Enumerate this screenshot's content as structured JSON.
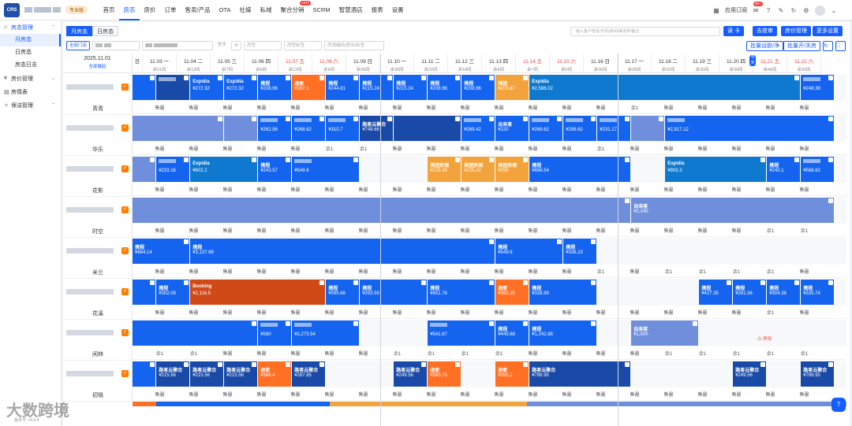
{
  "header": {
    "logo_text": "CRS",
    "pro_badge": "专业版",
    "nav": [
      {
        "label": "首页",
        "active": false,
        "hot": false
      },
      {
        "label": "房态",
        "active": true,
        "hot": false
      },
      {
        "label": "房价",
        "active": false,
        "hot": false
      },
      {
        "label": "订单",
        "active": false,
        "hot": false
      },
      {
        "label": "售卖/产品",
        "active": false,
        "hot": false
      },
      {
        "label": "OTA",
        "active": false,
        "hot": false
      },
      {
        "label": "社媒",
        "active": false,
        "hot": false
      },
      {
        "label": "私域",
        "active": false,
        "hot": false
      },
      {
        "label": "聚合分销",
        "active": false,
        "hot": true
      },
      {
        "label": "SCRM",
        "active": false,
        "hot": false
      },
      {
        "label": "智慧酒店",
        "active": false,
        "hot": false
      },
      {
        "label": "报表",
        "active": false,
        "hot": false
      },
      {
        "label": "设置",
        "active": false,
        "hot": false
      }
    ],
    "hot_label": "HOT",
    "apps_label": "应用订阅",
    "notify_count": "99+"
  },
  "sidebar": {
    "groups": [
      {
        "label": "房态管理",
        "icon": "home-icon",
        "subs": [
          "月房态",
          "日房态",
          "房态日志"
        ]
      },
      {
        "label": "房价管理",
        "icon": "price-icon",
        "subs": []
      },
      {
        "label": "房情表",
        "icon": "table-icon",
        "subs": []
      },
      {
        "label": "保洁管理",
        "icon": "broom-icon",
        "subs": []
      }
    ],
    "version": "版本号: v4.9.8"
  },
  "toolbar": {
    "tabs": [
      "月房态",
      "日房态"
    ],
    "search_placeholder": "输入客户姓名/手机/房间/渠道单/备注",
    "buttons": [
      "读 卡",
      "去夜审",
      "房价管理",
      "更多设置"
    ],
    "filter_all": "全部门店",
    "filter_more": "更多",
    "filter_type": "房型",
    "filter_tag": "房型标签",
    "filter_search": "房源编码/房间/标签",
    "batch_buttons": [
      "批量设脏/净",
      "批量开/关房"
    ]
  },
  "calendar": {
    "start_date": "2025.11.01",
    "expand_label": "全部展起",
    "days": [
      {
        "d": "日",
        "r": "",
        "we": false
      },
      {
        "d": "11.03 一",
        "r": "余21间",
        "we": false
      },
      {
        "d": "11.04 二",
        "r": "余13间",
        "we": false
      },
      {
        "d": "11.05 三",
        "r": "余7间",
        "we": false
      },
      {
        "d": "11.06 四",
        "r": "余8间",
        "we": false
      },
      {
        "d": "11.07 五",
        "r": "余12间",
        "we": true
      },
      {
        "d": "11.08 六",
        "r": "余9间",
        "we": true
      },
      {
        "d": "11.09 日",
        "r": "余26间",
        "we": false
      },
      {
        "d": "11.10 一",
        "r": "余30间",
        "we": false
      },
      {
        "d": "11.11 二",
        "r": "余22间",
        "we": false
      },
      {
        "d": "11.12 三",
        "r": "余18间",
        "we": false
      },
      {
        "d": "11.13 四",
        "r": "余8间",
        "we": false
      },
      {
        "d": "11.14 五",
        "r": "余7间",
        "we": true
      },
      {
        "d": "11.15 六",
        "r": "余5间",
        "we": true
      },
      {
        "d": "11.16 日",
        "r": "余35间",
        "we": false
      },
      {
        "d": "11.17 一",
        "r": "余35间",
        "we": false
      },
      {
        "d": "11.18 二",
        "r": "余32间",
        "we": false
      },
      {
        "d": "11.19 三",
        "r": "余35间",
        "we": false
      },
      {
        "d": "11.20 四",
        "r": "余39间",
        "we": false
      },
      {
        "d": "11.21 五",
        "r": "余46间",
        "we": true
      },
      {
        "d": "11.22 六",
        "r": "余39间",
        "we": true
      }
    ]
  },
  "rooms": [
    {
      "name": "青青",
      "bookings": [
        {
          "s": 0,
          "e": 1.4,
          "c": "c-blue",
          "n": "",
          "p": "",
          "blur": false
        },
        {
          "s": 1.4,
          "e": 2.4,
          "c": "c-dblue",
          "n": "",
          "p": "",
          "blur": true
        },
        {
          "s": 2.4,
          "e": 3.4,
          "c": "c-blue",
          "n": "Expidia",
          "p": "¥272.32",
          "blur": false
        },
        {
          "s": 3.4,
          "e": 4.4,
          "c": "c-blue",
          "n": "Expidia",
          "p": "¥272.32",
          "blur": false
        },
        {
          "s": 4.4,
          "e": 5.4,
          "c": "c-blue",
          "n": "携程",
          "p": "¥208.96",
          "blur": false
        },
        {
          "s": 5.4,
          "e": 6.4,
          "c": "c-orange",
          "n": "途家",
          "p": "¥287.1",
          "blur": false
        },
        {
          "s": 6.4,
          "e": 7.4,
          "c": "c-blue",
          "n": "携程",
          "p": "¥244.81",
          "blur": false
        },
        {
          "s": 7.4,
          "e": 8.4,
          "c": "c-blue",
          "n": "携程",
          "p": "¥215.24",
          "blur": false
        },
        {
          "s": 8.4,
          "e": 9.4,
          "c": "c-blue",
          "n": "携程",
          "p": "¥215.24",
          "blur": false
        },
        {
          "s": 9.4,
          "e": 10.4,
          "c": "c-blue",
          "n": "携程",
          "p": "¥208.96",
          "blur": false
        },
        {
          "s": 10.4,
          "e": 11.4,
          "c": "c-blue",
          "n": "携程",
          "p": "¥208.96",
          "blur": false
        },
        {
          "s": 11.4,
          "e": 12.4,
          "c": "c-yellow",
          "n": "美团",
          "p": "¥203.87",
          "blur": false
        },
        {
          "s": 12.4,
          "e": 20.4,
          "c": "c-sky",
          "n": "Expidia",
          "p": "¥2,566.02",
          "blur": false
        },
        {
          "s": 20.4,
          "e": 21.4,
          "c": "c-blue",
          "n": "",
          "p": "¥248.39",
          "blur": true
        }
      ],
      "sold": [
        "售罄",
        "售罄",
        "售罄",
        "售罄",
        "售罄",
        "售罄",
        "售罄",
        "售罄",
        "售罄",
        "售罄",
        "售罄",
        "售罄",
        "售罄",
        "售罄",
        "余1",
        "售罄",
        "售罄",
        "售罄",
        "售罄",
        "售罄"
      ]
    },
    {
      "name": "华乐",
      "bookings": [
        {
          "s": 0,
          "e": 3.4,
          "c": "c-light",
          "n": "",
          "p": "",
          "blur": false
        },
        {
          "s": 3.4,
          "e": 4.4,
          "c": "c-light",
          "n": "",
          "p": "",
          "blur": false
        },
        {
          "s": 4.4,
          "e": 5.4,
          "c": "c-blue",
          "n": "",
          "p": "¥262.56",
          "blur": true
        },
        {
          "s": 5.4,
          "e": 6.4,
          "c": "c-blue",
          "n": "",
          "p": "¥268.62",
          "blur": true
        },
        {
          "s": 6.4,
          "e": 7.4,
          "c": "c-blue",
          "n": "",
          "p": "¥310.7",
          "blur": true
        },
        {
          "s": 7.4,
          "e": 8.4,
          "c": "c-dblue",
          "n": "路客云聚合",
          "p": "¥748.66",
          "blur": false
        },
        {
          "s": 8.4,
          "e": 10.4,
          "c": "c-dblue",
          "n": "",
          "p": "",
          "blur": false
        },
        {
          "s": 10.4,
          "e": 11.4,
          "c": "c-blue",
          "n": "",
          "p": "¥269.42",
          "blur": true
        },
        {
          "s": 11.4,
          "e": 12.4,
          "c": "c-blue",
          "n": "自来客",
          "p": "¥220",
          "blur": false
        },
        {
          "s": 12.4,
          "e": 13.4,
          "c": "c-blue",
          "n": "",
          "p": "¥268.62",
          "blur": true
        },
        {
          "s": 13.4,
          "e": 14.4,
          "c": "c-blue",
          "n": "",
          "p": "¥268.62",
          "blur": true
        },
        {
          "s": 14.4,
          "e": 15.4,
          "c": "c-blue",
          "n": "",
          "p": "¥231.17",
          "blur": true
        },
        {
          "s": 15.4,
          "e": 16.4,
          "c": "c-light",
          "n": "",
          "p": "",
          "blur": false
        },
        {
          "s": 16.4,
          "e": 21.4,
          "c": "c-blue",
          "n": "",
          "p": "¥2,917.12",
          "blur": true
        }
      ],
      "sold": [
        "售罄",
        "售罄",
        "售罄",
        "售罄",
        "售罄",
        "余1",
        "余1",
        "售罄",
        "售罄",
        "售罄",
        "售罄",
        "售罄",
        "售罄",
        "余1",
        "售罄",
        "售罄",
        "售罄",
        "售罄",
        "售罄",
        "售罄"
      ]
    },
    {
      "name": "花影",
      "bookings": [
        {
          "s": 0,
          "e": 1.4,
          "c": "c-light",
          "n": "",
          "p": "",
          "blur": false
        },
        {
          "s": 1.4,
          "e": 2.4,
          "c": "c-blue",
          "n": "",
          "p": "¥233.16",
          "blur": true
        },
        {
          "s": 2.4,
          "e": 4.4,
          "c": "c-sky",
          "n": "Expidia",
          "p": "¥602.2",
          "blur": false
        },
        {
          "s": 4.4,
          "e": 5.4,
          "c": "c-blue",
          "n": "携程",
          "p": "¥243.57",
          "blur": false
        },
        {
          "s": 5.4,
          "e": 7.4,
          "c": "c-blue",
          "n": "",
          "p": "¥549.6",
          "blur": true
        },
        {
          "s": 9.4,
          "e": 10.4,
          "c": "c-yellow",
          "n": "美团民宿",
          "p": "¥225.43",
          "blur": false
        },
        {
          "s": 10.4,
          "e": 11.4,
          "c": "c-yellow",
          "n": "美团民宿",
          "p": "¥225.42",
          "blur": false
        },
        {
          "s": 11.4,
          "e": 12.4,
          "c": "c-yellow",
          "n": "美团民宿",
          "p": "¥298",
          "blur": false
        },
        {
          "s": 12.4,
          "e": 15.4,
          "c": "c-blue",
          "n": "携程",
          "p": "¥896.54",
          "blur": false
        },
        {
          "s": 16.4,
          "e": 19.4,
          "c": "c-sky",
          "n": "Expidia",
          "p": "¥903.3",
          "blur": false
        },
        {
          "s": 19.4,
          "e": 20.4,
          "c": "c-blue",
          "n": "携程",
          "p": "¥240.1",
          "blur": false
        },
        {
          "s": 20.4,
          "e": 21.4,
          "c": "c-blue",
          "n": "",
          "p": "¥588.62",
          "blur": true
        }
      ],
      "sold": [
        "售罄",
        "售罄",
        "售罄",
        "售罄",
        "售罄",
        "售罄",
        "售罄",
        "售罄",
        "售罄",
        "售罄",
        "售罄",
        "售罄",
        "售罄",
        "售罄",
        "售罄",
        "售罄",
        "售罄",
        "售罄",
        "售罄",
        "售罄"
      ]
    },
    {
      "name": "时空",
      "bookings": [
        {
          "s": 0,
          "e": 15.4,
          "c": "c-light",
          "n": "",
          "p": "",
          "blur": false
        },
        {
          "s": 15.4,
          "e": 21.4,
          "c": "c-light",
          "n": "自来客",
          "p": "¥2,240",
          "blur": false
        }
      ],
      "sold": [
        "售罄",
        "售罄",
        "售罄",
        "售罄",
        "售罄",
        "售罄",
        "售罄",
        "售罄",
        "售罄",
        "售罄",
        "售罄",
        "售罄",
        "售罄",
        "售罄",
        "售罄",
        "售罄",
        "售罄",
        "售罄",
        "余1",
        "余1"
      ]
    },
    {
      "name": "米兰",
      "bookings": [
        {
          "s": 0,
          "e": 2.4,
          "c": "c-blue",
          "n": "携程",
          "p": "¥664.14",
          "blur": false
        },
        {
          "s": 2.4,
          "e": 11.4,
          "c": "c-blue",
          "n": "携程",
          "p": "¥3,137.69",
          "blur": false
        },
        {
          "s": 11.4,
          "e": 13.4,
          "c": "c-blue",
          "n": "携程",
          "p": "¥549.6",
          "blur": false
        },
        {
          "s": 13.4,
          "e": 14.4,
          "c": "c-blue",
          "n": "携程",
          "p": "¥336.23",
          "blur": false
        }
      ],
      "sold": [
        "售罄",
        "售罄",
        "售罄",
        "售罄",
        "售罄",
        "售罄",
        "售罄",
        "售罄",
        "售罄",
        "售罄",
        "售罄",
        "售罄",
        "售罄",
        "余1",
        "售罄",
        "余1",
        "余1",
        "余1",
        "余1",
        "售罄"
      ]
    },
    {
      "name": "花溪",
      "bookings": [
        {
          "s": 0,
          "e": 1.4,
          "c": "c-blue",
          "n": "",
          "p": "",
          "blur": false
        },
        {
          "s": 1.4,
          "e": 2.4,
          "c": "c-blue",
          "n": "携程",
          "p": "¥302.09",
          "blur": false
        },
        {
          "s": 2.4,
          "e": 6.4,
          "c": "c-dorange",
          "n": "Booking",
          "p": "¥2,116.5",
          "blur": false
        },
        {
          "s": 6.4,
          "e": 7.4,
          "c": "c-blue",
          "n": "携程",
          "p": "¥595.68",
          "blur": false
        },
        {
          "s": 7.4,
          "e": 9.4,
          "c": "c-blue",
          "n": "携程",
          "p": "¥293.59",
          "blur": false
        },
        {
          "s": 9.4,
          "e": 11.4,
          "c": "c-blue",
          "n": "携程",
          "p": "¥651.76",
          "blur": false
        },
        {
          "s": 11.4,
          "e": 12.4,
          "c": "c-orange",
          "n": "途家",
          "p": "¥383.35",
          "blur": false
        },
        {
          "s": 12.4,
          "e": 14.4,
          "c": "c-blue",
          "n": "携程",
          "p": "¥338.99",
          "blur": false
        },
        {
          "s": 17.4,
          "e": 18.4,
          "c": "c-blue",
          "n": "携程",
          "p": "¥427.35",
          "blur": false
        },
        {
          "s": 18.4,
          "e": 19.4,
          "c": "c-blue",
          "n": "携程",
          "p": "¥281.56",
          "blur": false
        },
        {
          "s": 19.4,
          "e": 20.4,
          "c": "c-blue",
          "n": "携程",
          "p": "¥304.38",
          "blur": false
        },
        {
          "s": 20.4,
          "e": 21.4,
          "c": "c-blue",
          "n": "携程",
          "p": "¥335.74",
          "blur": false
        }
      ],
      "sold": [
        "售罄",
        "售罄",
        "售罄",
        "售罄",
        "售罄",
        "售罄",
        "售罄",
        "售罄",
        "售罄",
        "售罄",
        "售罄",
        "售罄",
        "售罄",
        "售罄",
        "售罄",
        "售罄",
        "售罄",
        "售罄",
        "余1",
        "售罄"
      ]
    },
    {
      "name": "闲林",
      "bookings": [
        {
          "s": 0,
          "e": 4.4,
          "c": "c-blue",
          "n": "",
          "p": "",
          "blur": false
        },
        {
          "s": 4.4,
          "e": 5.4,
          "c": "c-blue",
          "n": "",
          "p": "¥580",
          "blur": true
        },
        {
          "s": 5.4,
          "e": 7.4,
          "c": "c-blue",
          "n": "",
          "p": "¥2,273.54",
          "blur": true
        },
        {
          "s": 9.4,
          "e": 11.4,
          "c": "c-blue",
          "n": "",
          "p": "¥541.67",
          "blur": true
        },
        {
          "s": 11.4,
          "e": 12.4,
          "c": "c-blue",
          "n": "携程",
          "p": "¥449.88",
          "blur": false
        },
        {
          "s": 12.4,
          "e": 14.4,
          "c": "c-blue",
          "n": "携程",
          "p": "¥1,242.88",
          "blur": false
        },
        {
          "s": 15.4,
          "e": 17.4,
          "c": "c-light",
          "n": "自来客",
          "p": "¥1,500",
          "blur": false
        }
      ],
      "sold": [
        "余1",
        "余1",
        "售罄",
        "售罄",
        "售罄",
        "售罄",
        "售罄",
        "余1",
        "余1",
        "余1",
        "余1",
        "售罄",
        "售罄",
        "售罄",
        "售罄",
        "余1",
        "余1",
        "余1",
        "余1",
        "余1"
      ],
      "warn": {
        "at": 18,
        "label": "停用"
      }
    },
    {
      "name": "初晓",
      "bookings": [
        {
          "s": 0,
          "e": 1.4,
          "c": "c-blue",
          "n": "",
          "p": "",
          "blur": false
        },
        {
          "s": 1.4,
          "e": 2.4,
          "c": "c-dblue",
          "n": "路客云聚合",
          "p": "¥215.56",
          "blur": false
        },
        {
          "s": 2.4,
          "e": 3.4,
          "c": "c-dblue",
          "n": "路客云聚合",
          "p": "¥215.56",
          "blur": false
        },
        {
          "s": 3.4,
          "e": 4.4,
          "c": "c-dblue",
          "n": "路客云聚合",
          "p": "¥215.56",
          "blur": false
        },
        {
          "s": 4.4,
          "e": 5.4,
          "c": "c-orange",
          "n": "途家",
          "p": "¥360.4",
          "blur": false
        },
        {
          "s": 5.4,
          "e": 6.4,
          "c": "c-dblue",
          "n": "路客云聚合",
          "p": "¥287.85",
          "blur": false
        },
        {
          "s": 8.4,
          "e": 9.4,
          "c": "c-dblue",
          "n": "路客云聚合",
          "p": "¥249.56",
          "blur": false
        },
        {
          "s": 9.4,
          "e": 10.4,
          "c": "c-orange",
          "n": "途家",
          "p": "¥590.75",
          "blur": false
        },
        {
          "s": 11.4,
          "e": 12.4,
          "c": "c-orange",
          "n": "途家",
          "p": "¥355.2",
          "blur": false
        },
        {
          "s": 12.4,
          "e": 15.4,
          "c": "c-dblue",
          "n": "路客云聚合",
          "p": "¥786.95",
          "blur": false
        },
        {
          "s": 18.4,
          "e": 19.4,
          "c": "c-dblue",
          "n": "路客云聚合",
          "p": "¥249.56",
          "blur": false
        },
        {
          "s": 20.4,
          "e": 21.4,
          "c": "c-dblue",
          "n": "路客云聚合",
          "p": "¥786.95",
          "blur": false
        }
      ],
      "sold": [
        "售罄",
        "售罄",
        "售罄",
        "售罄",
        "售罄",
        "售罄",
        "售罄",
        "售罄",
        "售罄",
        "售罄",
        "售罄",
        "售罄",
        "售罄",
        "售罄",
        "售罄",
        "售罄",
        "售罄",
        "售罄",
        "售罄",
        "售罄"
      ]
    }
  ],
  "watermark": "大数跨境",
  "float_label": "?"
}
